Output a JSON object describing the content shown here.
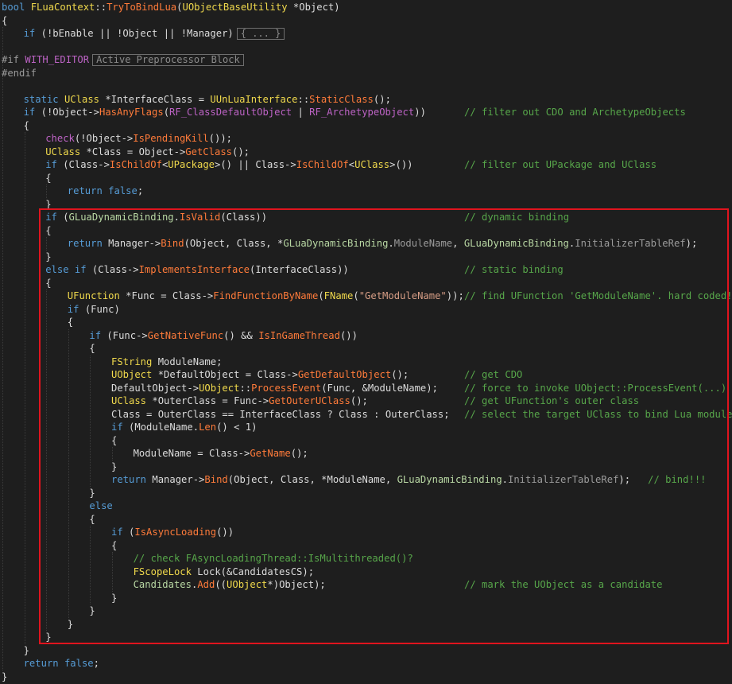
{
  "theme": {
    "background": "#1e1e1e",
    "highlight_color": "#e0141e",
    "token_colors": {
      "kw": "#569cd6",
      "cls": "#f0d94c",
      "fn": "#ff7b3a",
      "mac": "#bd63c5",
      "cm": "#57a64a",
      "str": "#d69d85",
      "var": "#b8d7a3",
      "tx": "#dcdcdc",
      "fld": "#9b9b9b",
      "pp": "#9b9b9b"
    }
  },
  "fold_hints": {
    "collapsed": "{ ... }",
    "preprocessor": "Active Preprocessor Block"
  },
  "code_lines": [
    {
      "indent": 0,
      "tokens": [
        {
          "t": "kw",
          "v": "bool "
        },
        {
          "t": "cls",
          "v": "FLuaContext"
        },
        {
          "t": "tx",
          "v": "::"
        },
        {
          "t": "fn",
          "v": "TryToBindLua"
        },
        {
          "t": "tx",
          "v": "("
        },
        {
          "t": "cls",
          "v": "UObjectBaseUtility"
        },
        {
          "t": "tx",
          "v": " *Object)"
        }
      ]
    },
    {
      "indent": 0,
      "tokens": [
        {
          "t": "tx",
          "v": "{"
        }
      ]
    },
    {
      "indent": 1,
      "tokens": [
        {
          "t": "kw",
          "v": "if "
        },
        {
          "t": "tx",
          "v": "(!bEnable || !Object || !Manager)"
        }
      ],
      "fold": "collapsed"
    },
    {
      "indent": 0,
      "tokens": []
    },
    {
      "indent": 0,
      "tokens": [
        {
          "t": "pp",
          "v": "#if "
        },
        {
          "t": "mac",
          "v": "WITH_EDITOR"
        }
      ],
      "fold": "preprocessor"
    },
    {
      "indent": 0,
      "tokens": [
        {
          "t": "pp",
          "v": "#endif"
        }
      ]
    },
    {
      "indent": 0,
      "tokens": []
    },
    {
      "indent": 1,
      "tokens": [
        {
          "t": "kw",
          "v": "static "
        },
        {
          "t": "cls",
          "v": "UClass"
        },
        {
          "t": "tx",
          "v": " *InterfaceClass = "
        },
        {
          "t": "cls",
          "v": "UUnLuaInterface"
        },
        {
          "t": "tx",
          "v": "::"
        },
        {
          "t": "fn",
          "v": "StaticClass"
        },
        {
          "t": "tx",
          "v": "();"
        }
      ]
    },
    {
      "indent": 1,
      "tokens": [
        {
          "t": "kw",
          "v": "if "
        },
        {
          "t": "tx",
          "v": "(!Object->"
        },
        {
          "t": "fn",
          "v": "HasAnyFlags"
        },
        {
          "t": "tx",
          "v": "("
        },
        {
          "t": "mac",
          "v": "RF_ClassDefaultObject"
        },
        {
          "t": "tx",
          "v": " | "
        },
        {
          "t": "mac",
          "v": "RF_ArchetypeObject"
        },
        {
          "t": "tx",
          "v": "))"
        }
      ],
      "comment": "// filter out CDO and ArchetypeObjects"
    },
    {
      "indent": 1,
      "tokens": [
        {
          "t": "tx",
          "v": "{"
        }
      ]
    },
    {
      "indent": 2,
      "tokens": [
        {
          "t": "mac",
          "v": "check"
        },
        {
          "t": "tx",
          "v": "(!Object->"
        },
        {
          "t": "fn",
          "v": "IsPendingKill"
        },
        {
          "t": "tx",
          "v": "());"
        }
      ]
    },
    {
      "indent": 2,
      "tokens": [
        {
          "t": "cls",
          "v": "UClass"
        },
        {
          "t": "tx",
          "v": " *Class = Object->"
        },
        {
          "t": "fn",
          "v": "GetClass"
        },
        {
          "t": "tx",
          "v": "();"
        }
      ]
    },
    {
      "indent": 2,
      "tokens": [
        {
          "t": "kw",
          "v": "if "
        },
        {
          "t": "tx",
          "v": "(Class->"
        },
        {
          "t": "fn",
          "v": "IsChildOf"
        },
        {
          "t": "tx",
          "v": "<"
        },
        {
          "t": "cls",
          "v": "UPackage"
        },
        {
          "t": "tx",
          "v": ">() || Class->"
        },
        {
          "t": "fn",
          "v": "IsChildOf"
        },
        {
          "t": "tx",
          "v": "<"
        },
        {
          "t": "cls",
          "v": "UClass"
        },
        {
          "t": "tx",
          "v": ">())"
        }
      ],
      "comment": "// filter out UPackage and UClass"
    },
    {
      "indent": 2,
      "tokens": [
        {
          "t": "tx",
          "v": "{"
        }
      ]
    },
    {
      "indent": 3,
      "tokens": [
        {
          "t": "kw",
          "v": "return false"
        },
        {
          "t": "tx",
          "v": ";"
        }
      ]
    },
    {
      "indent": 2,
      "tokens": [
        {
          "t": "tx",
          "v": "}"
        }
      ]
    },
    {
      "indent": 2,
      "tokens": [
        {
          "t": "kw",
          "v": "if "
        },
        {
          "t": "tx",
          "v": "("
        },
        {
          "t": "var",
          "v": "GLuaDynamicBinding"
        },
        {
          "t": "tx",
          "v": "."
        },
        {
          "t": "fn",
          "v": "IsValid"
        },
        {
          "t": "tx",
          "v": "(Class))"
        }
      ],
      "comment": "// dynamic binding"
    },
    {
      "indent": 2,
      "tokens": [
        {
          "t": "tx",
          "v": "{"
        }
      ]
    },
    {
      "indent": 3,
      "tokens": [
        {
          "t": "kw",
          "v": "return "
        },
        {
          "t": "tx",
          "v": "Manager->"
        },
        {
          "t": "fn",
          "v": "Bind"
        },
        {
          "t": "tx",
          "v": "(Object, Class, *"
        },
        {
          "t": "var",
          "v": "GLuaDynamicBinding"
        },
        {
          "t": "tx",
          "v": "."
        },
        {
          "t": "fld",
          "v": "ModuleName"
        },
        {
          "t": "tx",
          "v": ", "
        },
        {
          "t": "var",
          "v": "GLuaDynamicBinding"
        },
        {
          "t": "tx",
          "v": "."
        },
        {
          "t": "fld",
          "v": "InitializerTableRef"
        },
        {
          "t": "tx",
          "v": ");"
        }
      ]
    },
    {
      "indent": 2,
      "tokens": [
        {
          "t": "tx",
          "v": "}"
        }
      ]
    },
    {
      "indent": 2,
      "tokens": [
        {
          "t": "kw",
          "v": "else if "
        },
        {
          "t": "tx",
          "v": "(Class->"
        },
        {
          "t": "fn",
          "v": "ImplementsInterface"
        },
        {
          "t": "tx",
          "v": "(InterfaceClass))"
        }
      ],
      "comment": "// static binding"
    },
    {
      "indent": 2,
      "tokens": [
        {
          "t": "tx",
          "v": "{"
        }
      ]
    },
    {
      "indent": 3,
      "tokens": [
        {
          "t": "cls",
          "v": "UFunction"
        },
        {
          "t": "tx",
          "v": " *Func = Class->"
        },
        {
          "t": "fn",
          "v": "FindFunctionByName"
        },
        {
          "t": "tx",
          "v": "("
        },
        {
          "t": "cls",
          "v": "FName"
        },
        {
          "t": "tx",
          "v": "("
        },
        {
          "t": "str",
          "v": "\"GetModuleName\""
        },
        {
          "t": "tx",
          "v": "));"
        }
      ],
      "comment": "// find UFunction 'GetModuleName'. hard coded!!!"
    },
    {
      "indent": 3,
      "tokens": [
        {
          "t": "kw",
          "v": "if "
        },
        {
          "t": "tx",
          "v": "(Func)"
        }
      ]
    },
    {
      "indent": 3,
      "tokens": [
        {
          "t": "tx",
          "v": "{"
        }
      ]
    },
    {
      "indent": 4,
      "tokens": [
        {
          "t": "kw",
          "v": "if "
        },
        {
          "t": "tx",
          "v": "(Func->"
        },
        {
          "t": "fn",
          "v": "GetNativeFunc"
        },
        {
          "t": "tx",
          "v": "() && "
        },
        {
          "t": "fn",
          "v": "IsInGameThread"
        },
        {
          "t": "tx",
          "v": "())"
        }
      ]
    },
    {
      "indent": 4,
      "tokens": [
        {
          "t": "tx",
          "v": "{"
        }
      ]
    },
    {
      "indent": 5,
      "tokens": [
        {
          "t": "cls",
          "v": "FString"
        },
        {
          "t": "tx",
          "v": " ModuleName;"
        }
      ]
    },
    {
      "indent": 5,
      "tokens": [
        {
          "t": "cls",
          "v": "UObject"
        },
        {
          "t": "tx",
          "v": " *DefaultObject = Class->"
        },
        {
          "t": "fn",
          "v": "GetDefaultObject"
        },
        {
          "t": "tx",
          "v": "();"
        }
      ],
      "comment": "// get CDO"
    },
    {
      "indent": 5,
      "tokens": [
        {
          "t": "tx",
          "v": "DefaultObject->"
        },
        {
          "t": "cls",
          "v": "UObject"
        },
        {
          "t": "tx",
          "v": "::"
        },
        {
          "t": "fn",
          "v": "ProcessEvent"
        },
        {
          "t": "tx",
          "v": "(Func, &ModuleName);"
        }
      ],
      "comment": "// force to invoke UObject::ProcessEvent(...)"
    },
    {
      "indent": 5,
      "tokens": [
        {
          "t": "cls",
          "v": "UClass"
        },
        {
          "t": "tx",
          "v": " *OuterClass = Func->"
        },
        {
          "t": "fn",
          "v": "GetOuterUClass"
        },
        {
          "t": "tx",
          "v": "();"
        }
      ],
      "comment": "// get UFunction's outer class"
    },
    {
      "indent": 5,
      "tokens": [
        {
          "t": "tx",
          "v": "Class = OuterClass == InterfaceClass ? Class : OuterClass;"
        }
      ],
      "comment": "// select the target UClass to bind Lua module"
    },
    {
      "indent": 5,
      "tokens": [
        {
          "t": "kw",
          "v": "if "
        },
        {
          "t": "tx",
          "v": "(ModuleName."
        },
        {
          "t": "fn",
          "v": "Len"
        },
        {
          "t": "tx",
          "v": "() < 1)"
        }
      ]
    },
    {
      "indent": 5,
      "tokens": [
        {
          "t": "tx",
          "v": "{"
        }
      ]
    },
    {
      "indent": 6,
      "tokens": [
        {
          "t": "tx",
          "v": "ModuleName = Class->"
        },
        {
          "t": "fn",
          "v": "GetName"
        },
        {
          "t": "tx",
          "v": "();"
        }
      ]
    },
    {
      "indent": 5,
      "tokens": [
        {
          "t": "tx",
          "v": "}"
        }
      ]
    },
    {
      "indent": 5,
      "tokens": [
        {
          "t": "kw",
          "v": "return "
        },
        {
          "t": "tx",
          "v": "Manager->"
        },
        {
          "t": "fn",
          "v": "Bind"
        },
        {
          "t": "tx",
          "v": "(Object, Class, *ModuleName, "
        },
        {
          "t": "var",
          "v": "GLuaDynamicBinding"
        },
        {
          "t": "tx",
          "v": "."
        },
        {
          "t": "fld",
          "v": "InitializerTableRef"
        },
        {
          "t": "tx",
          "v": ");"
        },
        {
          "t": "cm",
          "v": "   // bind!!!"
        }
      ]
    },
    {
      "indent": 4,
      "tokens": [
        {
          "t": "tx",
          "v": "}"
        }
      ]
    },
    {
      "indent": 4,
      "tokens": [
        {
          "t": "kw",
          "v": "else"
        }
      ]
    },
    {
      "indent": 4,
      "tokens": [
        {
          "t": "tx",
          "v": "{"
        }
      ]
    },
    {
      "indent": 5,
      "tokens": [
        {
          "t": "kw",
          "v": "if "
        },
        {
          "t": "tx",
          "v": "("
        },
        {
          "t": "fn",
          "v": "IsAsyncLoading"
        },
        {
          "t": "tx",
          "v": "())"
        }
      ]
    },
    {
      "indent": 5,
      "tokens": [
        {
          "t": "tx",
          "v": "{"
        }
      ]
    },
    {
      "indent": 6,
      "tokens": [
        {
          "t": "cm",
          "v": "// check FAsyncLoadingThread::IsMultithreaded()?"
        }
      ]
    },
    {
      "indent": 6,
      "tokens": [
        {
          "t": "cls",
          "v": "FScopeLock"
        },
        {
          "t": "tx",
          "v": " Lock(&CandidatesCS);"
        }
      ]
    },
    {
      "indent": 6,
      "tokens": [
        {
          "t": "var",
          "v": "Candidates"
        },
        {
          "t": "tx",
          "v": "."
        },
        {
          "t": "fn",
          "v": "Add"
        },
        {
          "t": "tx",
          "v": "(("
        },
        {
          "t": "cls",
          "v": "UObject"
        },
        {
          "t": "tx",
          "v": "*)Object);"
        }
      ],
      "comment": "// mark the UObject as a candidate"
    },
    {
      "indent": 5,
      "tokens": [
        {
          "t": "tx",
          "v": "}"
        }
      ]
    },
    {
      "indent": 4,
      "tokens": [
        {
          "t": "tx",
          "v": "}"
        }
      ]
    },
    {
      "indent": 3,
      "tokens": [
        {
          "t": "tx",
          "v": "}"
        }
      ]
    },
    {
      "indent": 2,
      "tokens": [
        {
          "t": "tx",
          "v": "}"
        }
      ]
    },
    {
      "indent": 1,
      "tokens": [
        {
          "t": "tx",
          "v": "}"
        }
      ]
    },
    {
      "indent": 1,
      "tokens": [
        {
          "t": "kw",
          "v": "return false"
        },
        {
          "t": "tx",
          "v": ";"
        }
      ]
    },
    {
      "indent": 0,
      "tokens": [
        {
          "t": "tx",
          "v": "}"
        }
      ]
    }
  ]
}
